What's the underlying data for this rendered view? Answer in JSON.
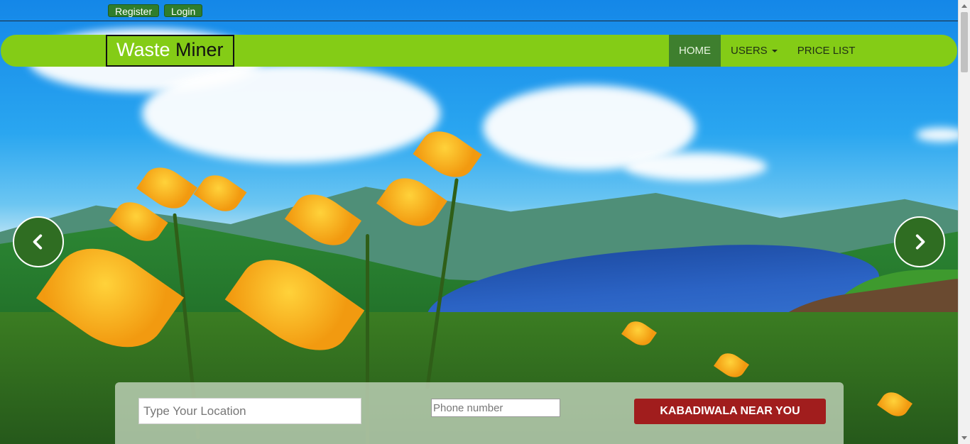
{
  "topbar": {
    "register_label": "Register",
    "login_label": "Login"
  },
  "navbar": {
    "brand_part1": "Waste",
    "brand_part2": "Miner",
    "items": [
      {
        "label": "HOME",
        "active": true
      },
      {
        "label": "USERS",
        "has_dropdown": true
      },
      {
        "label": "PRICE LIST"
      }
    ]
  },
  "carousel": {
    "prev_icon": "chevron-left-icon",
    "next_icon": "chevron-right-icon"
  },
  "search": {
    "location_placeholder": "Type Your Location",
    "phone_placeholder": "Phone number",
    "button_label": "KABADIWALA NEAR YOU"
  },
  "colors": {
    "navbar": "#84cc16",
    "nav_active": "#3e7f2e",
    "button_green": "#2f7d2c",
    "cta_red": "#a11d1d"
  }
}
